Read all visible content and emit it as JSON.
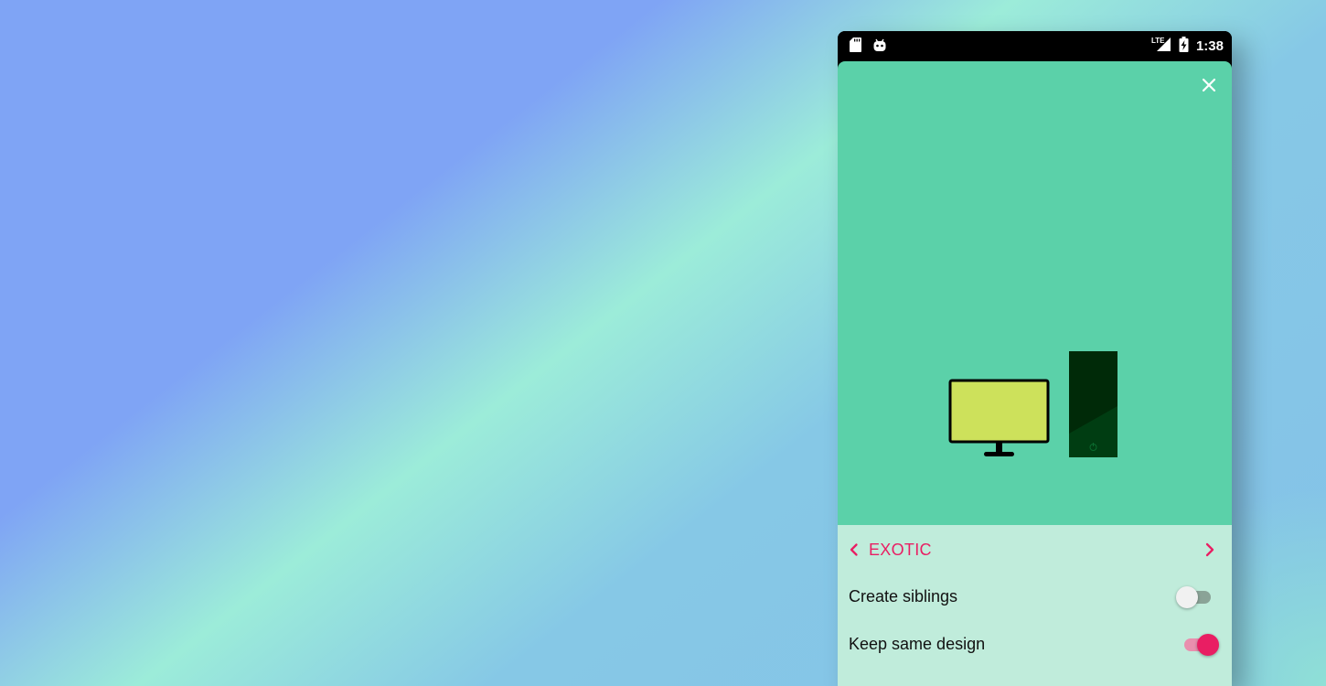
{
  "status_bar": {
    "time": "1:38",
    "network_label": "LTE",
    "left_icons": [
      "sd-card-icon",
      "android-icon"
    ],
    "right_icons": [
      "signal-icon",
      "battery-charging-icon"
    ]
  },
  "hero": {
    "background_color": "#5bd1a9",
    "close_icon": "close-icon",
    "illustration": {
      "monitor_color": "#cde15b",
      "tower_color": "#002a08"
    }
  },
  "panel": {
    "background_color": "#c0ecdb",
    "accent_color": "#e91e63",
    "category": {
      "label": "EXOTIC",
      "prev_icon": "chevron-left-icon",
      "next_icon": "chevron-right-icon"
    },
    "settings": [
      {
        "label": "Create siblings",
        "enabled": false
      },
      {
        "label": "Keep same design",
        "enabled": true
      }
    ]
  }
}
